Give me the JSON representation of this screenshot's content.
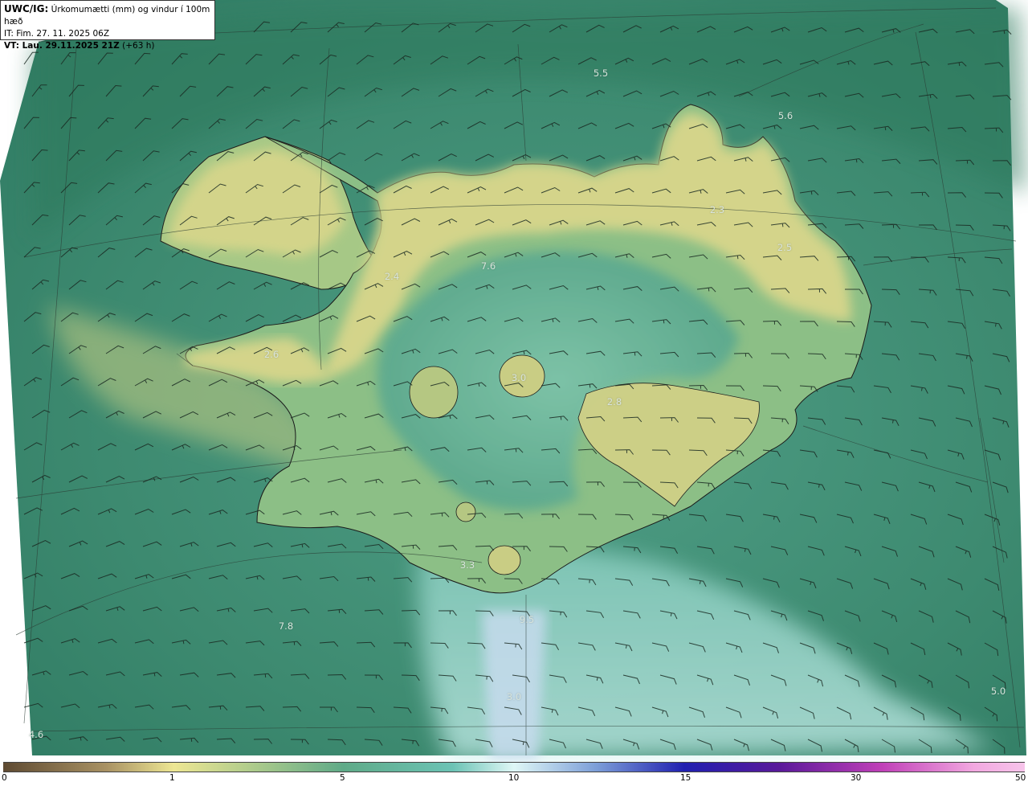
{
  "header": {
    "model": "UWC/IG:",
    "title": "Úrkomumætti (mm) og vindur í 100m hæð",
    "init_time": "IT: Fim. 27. 11. 2025 06Z",
    "valid_time": "VT: Lau. 29.11.2025 21Z",
    "lead": "(+63 h)"
  },
  "map_labels": [
    "5.5",
    "5.6",
    "7.6",
    "2.4",
    "2.6",
    "2.5",
    "2.3",
    "3.0",
    "2.8",
    "3.3",
    "7.8",
    "9.5",
    "5.0",
    "3.0",
    "4.6"
  ],
  "colorbar": {
    "ticks": [
      "0",
      "1",
      "5",
      "10",
      "15",
      "30",
      "50"
    ]
  },
  "colors": {
    "ocean": "#3f8f74",
    "land_high": "#e2d98a",
    "land_mid": "#9fc284",
    "low_water": "#bfe9e4",
    "barb": "#1a2a22"
  }
}
